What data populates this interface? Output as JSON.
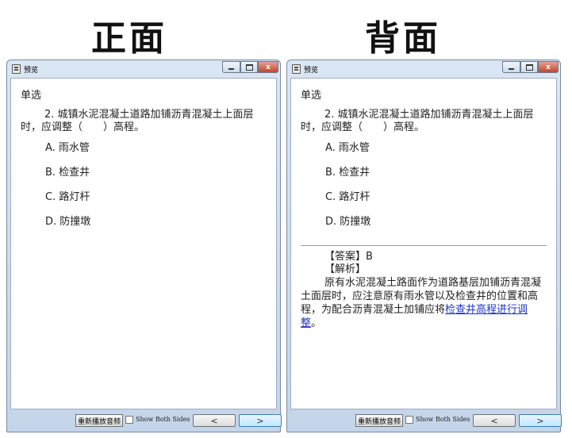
{
  "labels": {
    "front": "正面",
    "back": "背面"
  },
  "front": {
    "window_title": "预览",
    "question_type": "单选",
    "stem": "2. 城镇水泥混凝土道路加铺沥青混凝土上面层时，应调整（　　）高程。",
    "options": [
      {
        "text": "A.  雨水管"
      },
      {
        "text": "B.  检查井"
      },
      {
        "text": "C.  路灯杆"
      },
      {
        "text": "D.  防撞墩"
      }
    ],
    "footer": {
      "replay_label": "重新播放音频",
      "show_both_label": "Show Both Sides",
      "show_both_checked": false,
      "prev_glyph": "<",
      "next_glyph": ">"
    }
  },
  "back": {
    "window_title": "预览",
    "question_type": "单选",
    "stem": "2. 城镇水泥混凝土道路加铺沥青混凝土上面层时，应调整（　　）高程。",
    "options": [
      {
        "text": "A.  雨水管"
      },
      {
        "text": "B.  检查井"
      },
      {
        "text": "C.  路灯杆"
      },
      {
        "text": "D.  防撞墩"
      }
    ],
    "answer": "【答案】B",
    "analysis_heading": "【解析】",
    "analysis_text": "原有水泥混凝土路面作为道路基层加铺沥青混凝土面层时，应注意原有雨水管以及检查井的位置和高程，为配合沥青混凝土加铺应将",
    "analysis_link": "检查井高程进行调整",
    "analysis_end": "。",
    "footer": {
      "replay_label": "重新播放音频",
      "show_both_label": "Show Both Sides",
      "show_both_checked": false,
      "prev_glyph": "<",
      "next_glyph": ">"
    }
  },
  "window_controls": {
    "close_glyph": "x"
  },
  "colors": {
    "link": "#1f33cc",
    "close_button": "#c3452d",
    "next_button": "#bee6fd"
  }
}
